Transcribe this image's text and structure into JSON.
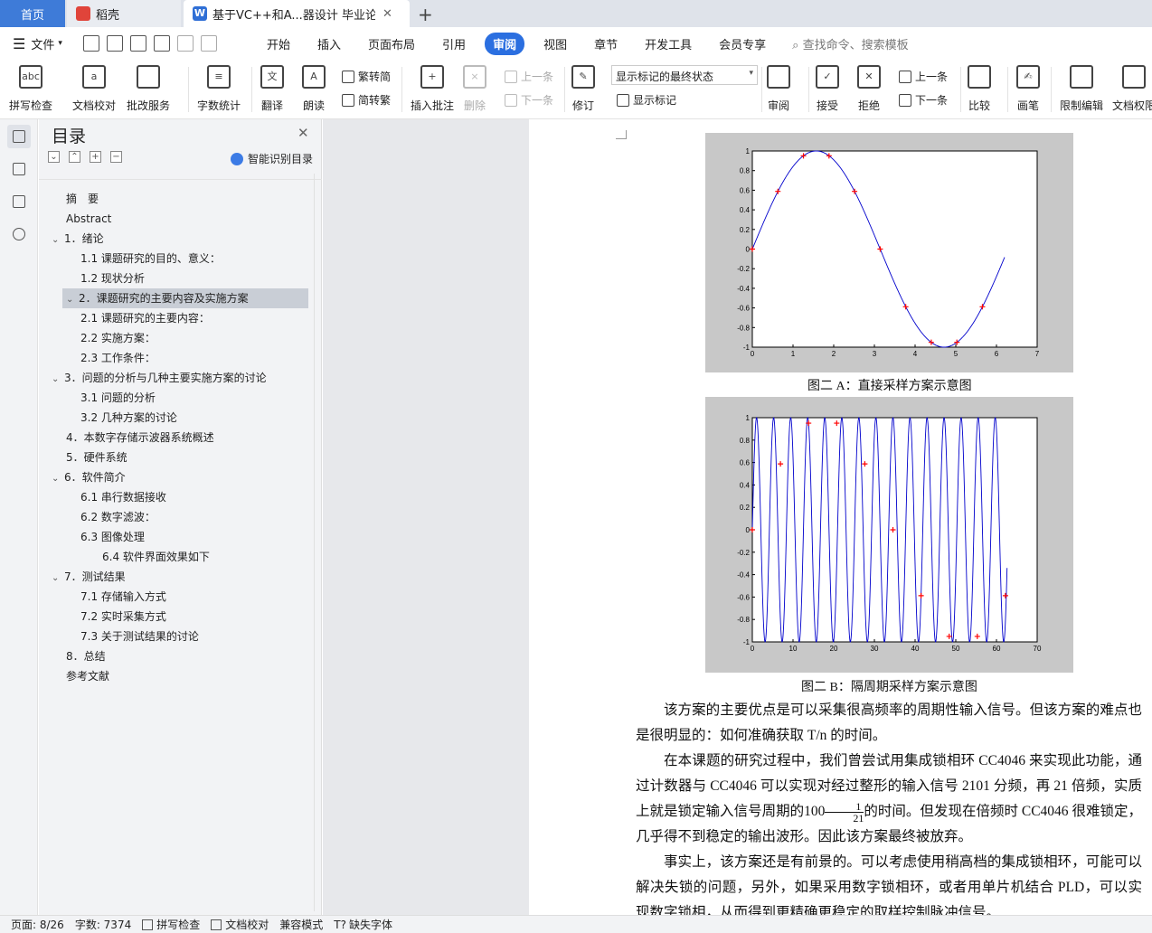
{
  "tabs": {
    "home": "首页",
    "daoke": "稻壳",
    "doc": "基于VC++和A...器设计 毕业论文"
  },
  "menu": {
    "file": "文件",
    "items": [
      "开始",
      "插入",
      "页面布局",
      "引用",
      "审阅",
      "视图",
      "章节",
      "开发工具",
      "会员专享"
    ],
    "active": "审阅",
    "search": "查找命令、搜索模板"
  },
  "ribbon": {
    "spell": "拼写检查",
    "proof": "文档校对",
    "annot_service": "批改服务",
    "word_count": "字数统计",
    "translate": "翻译",
    "read_aloud": "朗读",
    "trad": "繁转简",
    "simp": "简转繁",
    "insert_comment": "插入批注",
    "delete": "删除",
    "prev_comment": "上一条",
    "next_comment": "下一条",
    "revise": "修订",
    "markup_state": "显示标记的最终状态",
    "show_markup": "显示标记",
    "review": "审阅",
    "accept": "接受",
    "reject": "拒绝",
    "prev": "上一条",
    "next": "下一条",
    "compare": "比较",
    "pen": "画笔",
    "restrict": "限制编辑",
    "doc_perm": "文档权限"
  },
  "toc": {
    "title": "目录",
    "smart": "智能识别目录",
    "items": [
      {
        "label": "摘　要",
        "level": 0,
        "arrow": ""
      },
      {
        "label": "Abstract",
        "level": 0,
        "arrow": ""
      },
      {
        "label": "1．绪论",
        "level": 0,
        "arrow": "v"
      },
      {
        "label": "1.1 课题研究的目的、意义：",
        "level": 1,
        "arrow": ""
      },
      {
        "label": "1.2 现状分析",
        "level": 1,
        "arrow": ""
      },
      {
        "label": "2．课题研究的主要内容及实施方案",
        "level": 0,
        "arrow": "v"
      },
      {
        "label": "2.1 课题研究的主要内容：",
        "level": 1,
        "arrow": ""
      },
      {
        "label": "2.2 实施方案：",
        "level": 1,
        "arrow": ""
      },
      {
        "label": "2.3 工作条件：",
        "level": 1,
        "arrow": ""
      },
      {
        "label": "3．问题的分析与几种主要实施方案的讨论",
        "level": 0,
        "arrow": "v"
      },
      {
        "label": "3.1 问题的分析",
        "level": 1,
        "arrow": ""
      },
      {
        "label": "3.2 几种方案的讨论",
        "level": 1,
        "arrow": ""
      },
      {
        "label": "4．本数字存储示波器系统概述",
        "level": 0,
        "arrow": ""
      },
      {
        "label": "5．硬件系统",
        "level": 0,
        "arrow": ""
      },
      {
        "label": "6．软件简介",
        "level": 0,
        "arrow": "v"
      },
      {
        "label": "6.1 串行数据接收",
        "level": 1,
        "arrow": ""
      },
      {
        "label": "6.2 数字滤波：",
        "level": 1,
        "arrow": ""
      },
      {
        "label": "6.3 图像处理",
        "level": 1,
        "arrow": ""
      },
      {
        "label": "6.4 软件界面效果如下",
        "level": 2,
        "arrow": ""
      },
      {
        "label": "7．测试结果",
        "level": 0,
        "arrow": "v"
      },
      {
        "label": "7.1 存储输入方式",
        "level": 1,
        "arrow": ""
      },
      {
        "label": "7.2 实时采集方式",
        "level": 1,
        "arrow": ""
      },
      {
        "label": "7.3 关于测试结果的讨论",
        "level": 1,
        "arrow": ""
      },
      {
        "label": "8．总结",
        "level": 0,
        "arrow": ""
      },
      {
        "label": "参考文献",
        "level": 0,
        "arrow": ""
      }
    ],
    "selected_index": 5
  },
  "document": {
    "caption_a": "图二 A：直接采样方案示意图",
    "caption_b": "图二 B：隔周期采样方案示意图",
    "p1": "该方案的主要优点是可以采集很高频率的周期性输入信号。但该方案的难点也是很明显的：如何准确获取 T/n 的时间。",
    "p2_a": "在本课题的研究过程中，我们曾尝试用集成锁相环 CC4046 来实现此功能，通过计数器与 CC4046 可以实现对经过整形的输入信号 2101 分频，再 21 倍频，实质上就是锁定输入信号周期的100",
    "p2_frac_num": "1",
    "p2_frac_den": "21",
    "p2_b": "的时间。但发现在倍频时 CC4046 很难锁定，几乎得不到稳定的输出波形。因此该方案最终被放弃。",
    "p3": "事实上，该方案还是有前景的。可以考虑使用稍高档的集成锁相环，可能可以解决失锁的问题，另外，如果采用数字锁相环，或者用单片机结合 PLD，可以实现数字锁相，从而得到更精确更稳定的取样控制脉冲信号。"
  },
  "chart_data": [
    {
      "type": "line",
      "x_ticks": [
        0,
        1,
        2,
        3,
        4,
        5,
        6,
        7
      ],
      "y_ticks": [
        -1,
        -0.8,
        -0.6,
        -0.4,
        -0.2,
        0,
        0.2,
        0.4,
        0.6,
        0.8,
        1
      ],
      "xlim": [
        0,
        7
      ],
      "ylim": [
        -1,
        1
      ],
      "series": [
        {
          "kind": "curve",
          "function": "sin",
          "x_range": [
            0,
            6.2
          ],
          "color": "#0000cc"
        },
        {
          "kind": "markers",
          "color": "#ff0000",
          "x": [
            0,
            0.628,
            1.257,
            1.885,
            2.513,
            3.142,
            3.77,
            4.398,
            5.027,
            5.655
          ],
          "y": [
            0,
            0.588,
            0.951,
            0.951,
            0.588,
            0,
            -0.588,
            -0.951,
            -0.951,
            -0.588
          ]
        }
      ]
    },
    {
      "type": "line",
      "x_ticks": [
        0,
        10,
        20,
        30,
        40,
        50,
        60,
        70
      ],
      "y_ticks": [
        -1,
        -0.8,
        -0.6,
        -0.4,
        -0.2,
        0,
        0.2,
        0.4,
        0.6,
        0.8,
        1
      ],
      "xlim": [
        0,
        70
      ],
      "ylim": [
        -1,
        1
      ],
      "series": [
        {
          "kind": "curve",
          "function": "sin",
          "x_range": [
            0,
            62.6
          ],
          "color": "#0000cc"
        },
        {
          "kind": "markers",
          "color": "#ff0000",
          "x": [
            0,
            6.912,
            13.823,
            20.735,
            27.646,
            34.558,
            41.469,
            48.381,
            55.292,
            62.204
          ],
          "y": [
            0,
            0.588,
            0.951,
            0.951,
            0.588,
            0,
            -0.588,
            -0.951,
            -0.951,
            -0.588
          ]
        }
      ]
    }
  ],
  "status": {
    "page": "页面: 8/26",
    "words": "字数: 7374",
    "spell": "拼写检查",
    "proof": "文档校对",
    "compat": "兼容模式",
    "missing_font": "缺失字体"
  }
}
